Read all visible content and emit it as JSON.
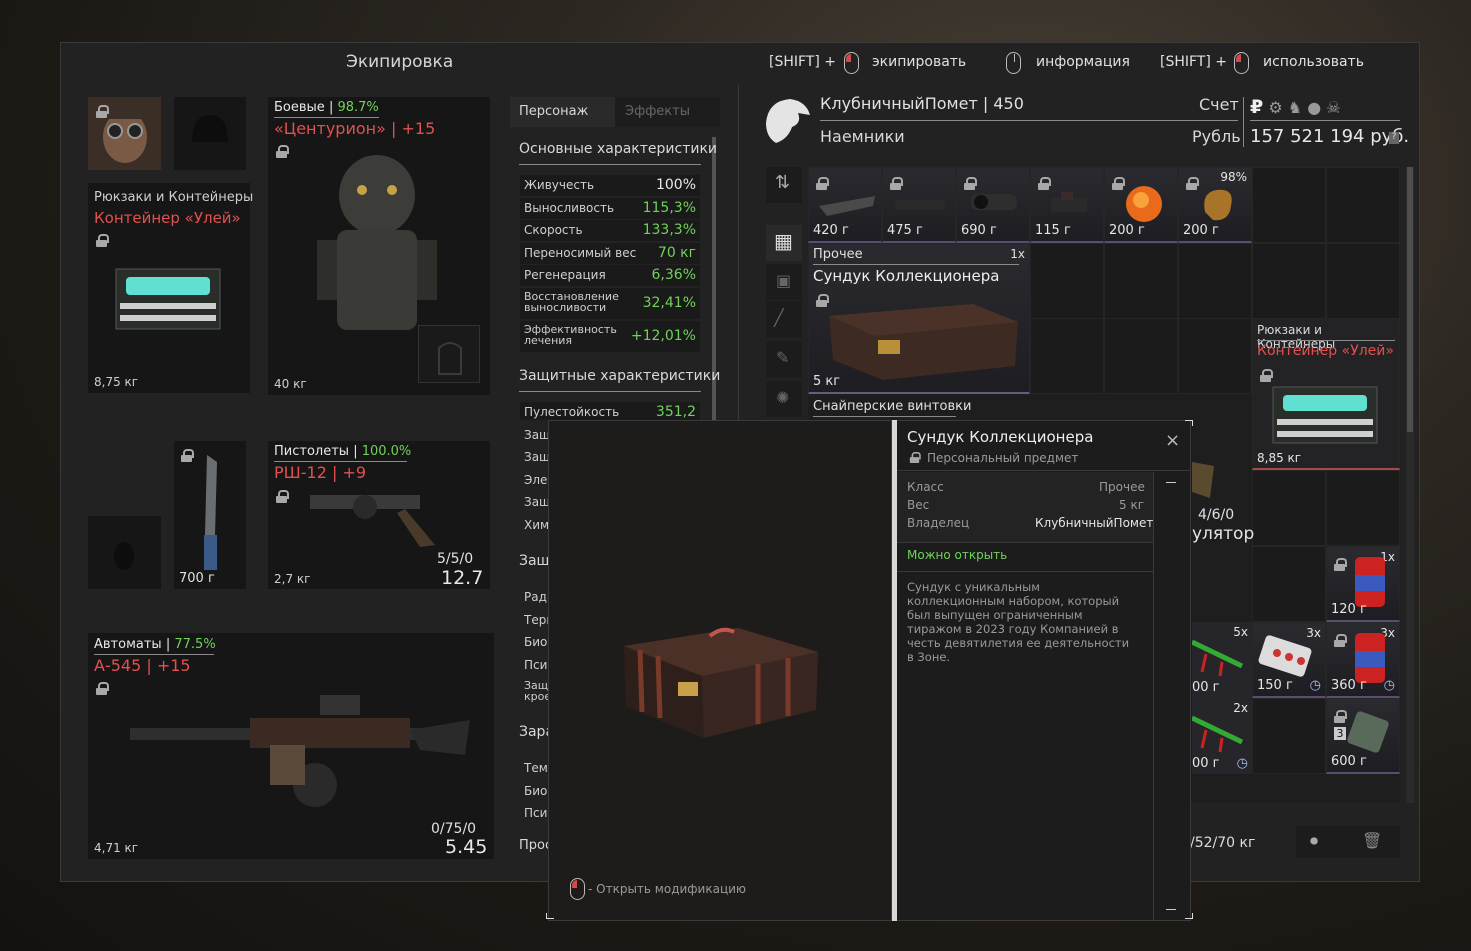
{
  "window": {
    "title": "Экипировка"
  },
  "hints": {
    "shift1": "[SHIFT] +",
    "equip": "экипировать",
    "info": "информация",
    "shift2": "[SHIFT] +",
    "use": "использовать"
  },
  "equipment": {
    "backpack_category": "Рюкзаки и Контейнеры",
    "backpack_name": "Контейнер «Улей»",
    "backpack_weight": "8,75 кг",
    "armor_category": "Боевые",
    "armor_pct": "98.7%",
    "armor_name": "«Центурион»",
    "armor_upgrade": "+15",
    "armor_weight": "40 кг",
    "knife_price": "700 г",
    "pistol_category": "Пистолеты",
    "pistol_pct": "100.0%",
    "pistol_name": "РШ-12",
    "pistol_upgrade": "+9",
    "pistol_ammo": "5/5/0",
    "pistol_caliber": "12.7",
    "pistol_weight": "2,7 кг",
    "rifle_category": "Автоматы",
    "rifle_pct": "77.5%",
    "rifle_name": "А-545",
    "rifle_upgrade": "+15",
    "rifle_ammo": "0/75/0",
    "rifle_caliber": "5.45",
    "rifle_weight": "4,71 кг",
    "sep": "|"
  },
  "stats": {
    "tab_character": "Персонаж",
    "tab_effects": "Эффекты",
    "basic_title": "Основные характеристики",
    "basic": [
      {
        "k": "Живучесть",
        "v": "100%"
      },
      {
        "k": "Выносливость",
        "v": "115,3%"
      },
      {
        "k": "Скорость",
        "v": "133,3%"
      },
      {
        "k": "Переносимый вес",
        "v": "70 кг"
      },
      {
        "k": "Регенерация",
        "v": "6,36%"
      },
      {
        "k": "Восстановление выносливости",
        "v": "32,41%"
      },
      {
        "k": "Эффективность лечения",
        "v": "+12,01%"
      }
    ],
    "protect_title": "Защитные характеристики",
    "bullet_k": "Пулестойкость",
    "bullet_v": "351,2",
    "partial": [
      "Защ",
      "Защ",
      "Элек",
      "Защ",
      "Хим"
    ],
    "partial2_title": "Защ",
    "partial2": [
      "Ради",
      "Терм",
      "Биоз",
      "Пси-",
      "Защ крое"
    ],
    "partial3_title": "Зара",
    "partial3": [
      "Темі",
      "Биоз",
      "Пси-"
    ],
    "partial4": "Прос"
  },
  "profile": {
    "name": "КлубничныйПомет",
    "level": "450",
    "faction": "Наемники",
    "account_label": "Счет",
    "currency_label": "Рубль",
    "balance": "157 521 194 руб.",
    "help": "?"
  },
  "stash": {
    "items": [
      {
        "price": "420 г"
      },
      {
        "price": "475 г"
      },
      {
        "price": "690 г"
      },
      {
        "price": "115 г"
      },
      {
        "price": "200 г"
      },
      {
        "price": "200 г",
        "pct": "98%"
      }
    ],
    "misc_label": "Прочее",
    "misc_count": "1x",
    "chest_name": "Сундук Коллекционера",
    "chest_weight": "5 кг",
    "sniper_label": "Снайперские винтовки",
    "bp_category": "Рюкзаки и Контейнеры",
    "bp_name": "Контейнер «Улей»",
    "bp_weight": "8,85 кг",
    "partial_ammo": "4/6/0",
    "partial_name": "улятор",
    "cans": [
      {
        "count": "1x",
        "price": "120 г"
      },
      {
        "count": "3x",
        "price": "360 г"
      }
    ],
    "pills": {
      "count": "3x",
      "price": "150 г"
    },
    "inj1": {
      "count": "5x",
      "price": "00 г"
    },
    "inj2": {
      "count": "2x",
      "price": "00 г"
    },
    "batt": {
      "badge": "3",
      "price": "600 г"
    },
    "weight": "/52/70 кг"
  },
  "tooltip": {
    "title": "Сундук Коллекционера",
    "subtitle": "Персональный предмет",
    "class_k": "Класс",
    "class_v": "Прочее",
    "weight_k": "Вес",
    "weight_v": "5 кг",
    "owner_k": "Владелец",
    "owner_v": "КлубничныйПомет",
    "can_open": "Можно открыть",
    "description": "Сундук с уникальным коллекционным набором, который был выпущен ограниченным тиражом в 2023 году Компанией в честь девятилетия ее деятельности в Зоне.",
    "open_hint": "- Открыть модификацию"
  }
}
